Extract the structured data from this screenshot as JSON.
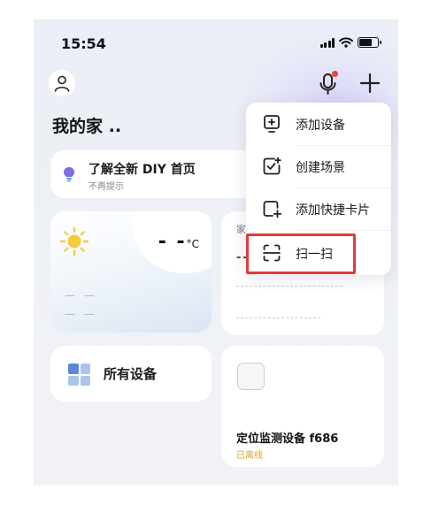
{
  "status_bar": {
    "time": "15:54"
  },
  "header": {
    "home_title": "我的家 .."
  },
  "diy_card": {
    "title": "了解全新 DIY 首页",
    "subtitle": "不再提示"
  },
  "weather": {
    "temperature": "- -",
    "unit": "°C",
    "row1": "— —",
    "row2": "— —"
  },
  "env_card": {
    "label": "家",
    "value": "--"
  },
  "all_devices": {
    "label": "所有设备"
  },
  "device": {
    "name": "定位监测设备 f686",
    "status": "已离线"
  },
  "menu": {
    "items": [
      {
        "label": "添加设备",
        "icon": "add-device-icon"
      },
      {
        "label": "创建场景",
        "icon": "create-scene-icon"
      },
      {
        "label": "添加快捷卡片",
        "icon": "add-shortcut-card-icon"
      },
      {
        "label": "扫一扫",
        "icon": "scan-icon"
      }
    ]
  },
  "colors": {
    "accent": "#e23a3a",
    "offline": "#e0a020",
    "notification_dot": "#e8453c"
  }
}
